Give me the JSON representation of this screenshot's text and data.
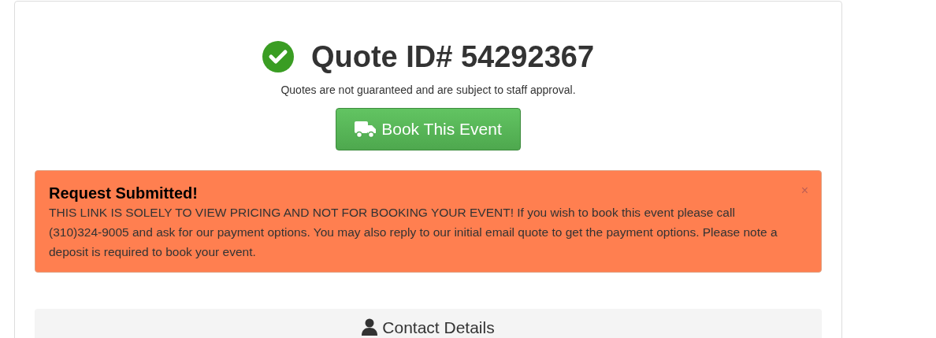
{
  "quote": {
    "title": "Quote ID# 54292367",
    "note": "Quotes are not guaranteed and are subject to staff approval.",
    "book_button": "Book This Event"
  },
  "alert": {
    "heading": "Request Submitted!",
    "message": "THIS LINK IS SOLELY TO VIEW PRICING AND NOT FOR BOOKING YOUR EVENT! If you wish to book this event please call (310)324-9005 and ask for our payment options. You may also reply to our initial email quote to get the payment options. Please note a deposit is required to book your event.",
    "close": "×"
  },
  "section": {
    "title": "Contact Details"
  }
}
